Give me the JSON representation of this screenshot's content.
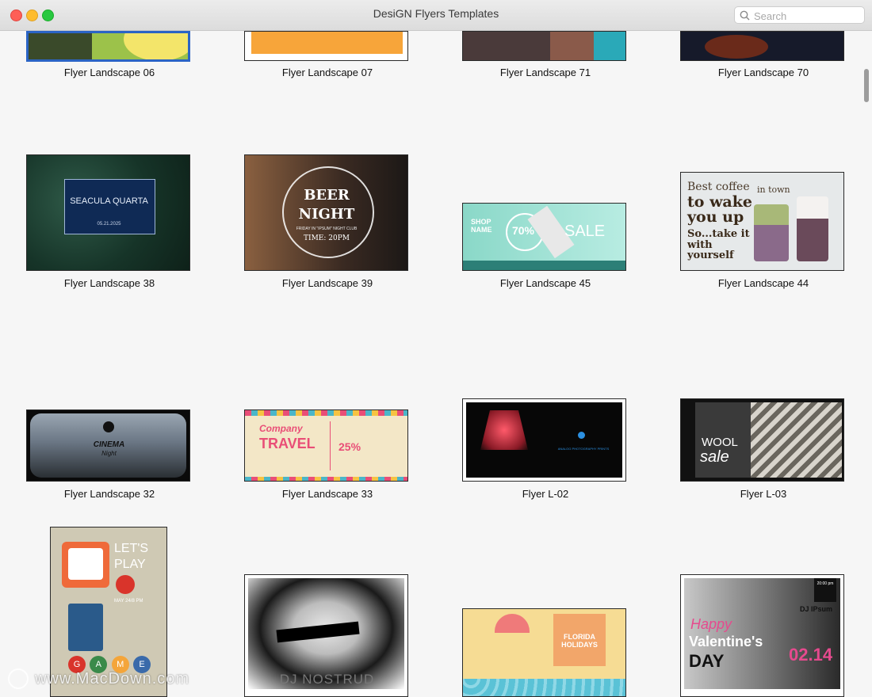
{
  "window": {
    "title": "DesiGN Flyers Templates"
  },
  "search": {
    "placeholder": "Search",
    "icon": "magnifier-icon"
  },
  "colors": {
    "selection": "#2b64c5",
    "background": "#f6f6f6"
  },
  "templates": [
    {
      "label": "Flyer Landscape 06"
    },
    {
      "label": "Flyer Landscape 07"
    },
    {
      "label": "Flyer Landscape 71"
    },
    {
      "label": "Flyer Landscape 70"
    },
    {
      "label": "Flyer Landscape 38",
      "thumb": {
        "title": "SEACULA QUARTA",
        "date": "05.21.2025"
      }
    },
    {
      "label": "Flyer Landscape 39",
      "thumb": {
        "line1": "BEER",
        "line2": "NIGHT",
        "sub": "FRIDAY IN \"IPSUM\" NIGHT CLUB",
        "time": "TIME: 20PM"
      }
    },
    {
      "label": "Flyer Landscape 45",
      "thumb": {
        "left": "SHOP NAME",
        "percent": "70%",
        "word": "SALE"
      }
    },
    {
      "label": "Flyer Landscape 44",
      "thumb": {
        "l1": "Best coffee",
        "l2": "in town",
        "l3": "to wake",
        "l4": "you up",
        "l5": "So...take it",
        "l6": "with",
        "l7": "yourself"
      }
    },
    {
      "label": "Flyer Landscape 32",
      "thumb": {
        "word": "CINEMA",
        "sub": "Night"
      }
    },
    {
      "label": "Flyer Landscape 33",
      "thumb": {
        "l1": "Company",
        "l2": "TRAVEL",
        "pct": "25%"
      }
    },
    {
      "label": "Flyer L-02",
      "thumb": {
        "text": "ANALOG PHOTOGRAPHY PRINTS"
      }
    },
    {
      "label": "Flyer L-03",
      "thumb": {
        "l1": "WOOL",
        "l2": "sale"
      }
    },
    {
      "thumb": {
        "l1": "LET'S",
        "l2": "PLAY",
        "date": "MAY 24/8 PM",
        "letters": [
          "G",
          "A",
          "M",
          "E"
        ]
      }
    },
    {
      "thumb": {
        "text": "DJ NOSTRUD"
      }
    },
    {
      "thumb": {
        "text": "FLORIDA HOLIDAYS"
      }
    },
    {
      "thumb": {
        "l1": "Happy",
        "l2": "Valentine's",
        "l3": "DAY",
        "date": "02.14",
        "dj": "DJ IPsum",
        "time": "20:00 pm"
      }
    }
  ],
  "watermark": {
    "text": "www.MacDown.com"
  }
}
